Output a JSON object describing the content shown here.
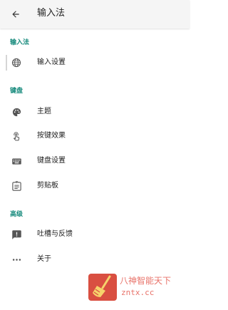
{
  "header": {
    "title": "输入法"
  },
  "sections": {
    "ime": {
      "label": "输入法"
    },
    "keyboard": {
      "label": "键盘"
    },
    "advanced": {
      "label": "高级"
    }
  },
  "items": {
    "input_settings": {
      "label": "输入设置",
      "icon": "globe-icon"
    },
    "theme": {
      "label": "主题",
      "icon": "palette-icon"
    },
    "key_effects": {
      "label": "按键效果",
      "icon": "touch-icon"
    },
    "keyboard_settings": {
      "label": "键盘设置",
      "icon": "keyboard-icon"
    },
    "clipboard": {
      "label": "剪贴板",
      "icon": "clipboard-icon"
    },
    "feedback": {
      "label": "吐槽与反馈",
      "icon": "feedback-icon"
    },
    "about": {
      "label": "关于",
      "icon": "more-icon"
    }
  },
  "watermark": {
    "line1": "八神智能天下",
    "line2": "zntx.cc"
  },
  "colors": {
    "accent": "#14897b",
    "topbar": "#f5f5f5",
    "text": "#212121",
    "icon": "#555555",
    "watermark": "#d94f41"
  }
}
